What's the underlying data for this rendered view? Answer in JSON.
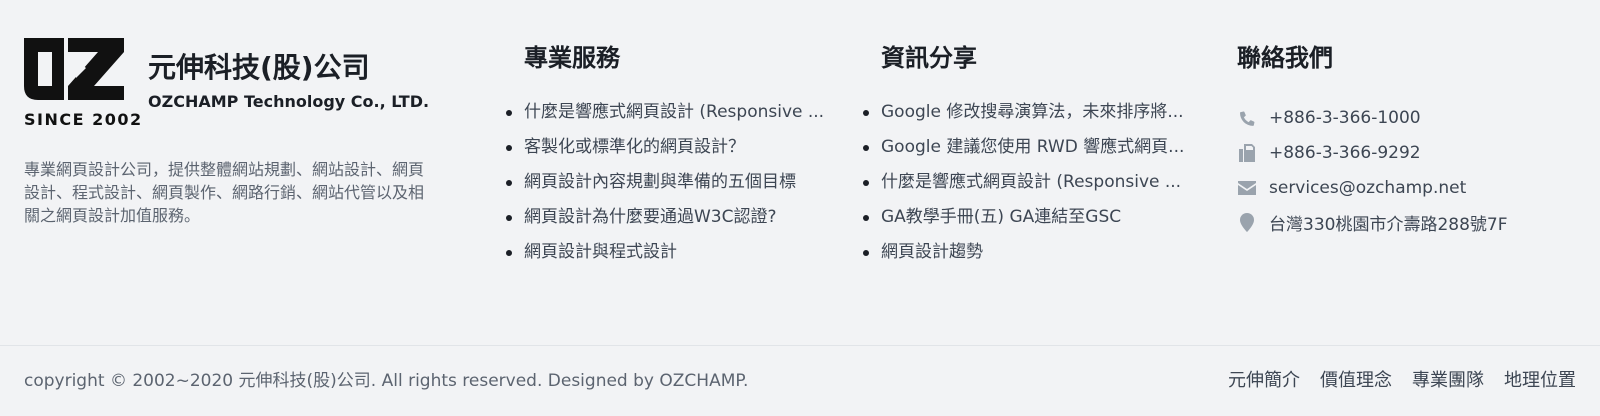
{
  "brand": {
    "since": "SINCE 2002",
    "name_cn": "元伸科技(股)公司",
    "name_en": "OZCHAMP Technology Co., LTD.",
    "description": "專業網頁設計公司，提供整體網站規劃、網站設計、網頁設計、程式設計、網頁製作、網路行銷、網站代管以及相關之網頁設計加值服務。"
  },
  "services": {
    "title": "專業服務",
    "items": [
      "什麼是響應式網頁設計 (Responsive ...",
      "客製化或標準化的網頁設計？",
      "網頁設計內容規劃與準備的五個目標",
      "網頁設計為什麼要通過W3C認證?",
      "網頁設計與程式設計"
    ]
  },
  "news": {
    "title": "資訊分享",
    "items": [
      "Google 修改搜尋演算法，未來排序將...",
      "Google 建議您使用 RWD 響應式網頁...",
      "什麼是響應式網頁設計 (Responsive ...",
      "GA教學手冊(五) GA連結至GSC",
      "網頁設計趨勢"
    ]
  },
  "contact": {
    "title": "聯絡我們",
    "phone": "+886-3-366-1000",
    "fax": "+886-3-366-9292",
    "email": "services@ozchamp.net",
    "address": "台灣330桃園市介壽路288號7F"
  },
  "footer": {
    "copyright": "copyright © 2002~2020 元伸科技(股)公司. All rights reserved. Designed by  OZCHAMP.",
    "nav": [
      "元伸簡介",
      "價值理念",
      "專業團隊",
      "地理位置"
    ]
  },
  "icons": {
    "phone": "phone-icon",
    "fax": "fax-icon",
    "email": "envelope-icon",
    "address": "map-marker-icon"
  },
  "colors": {
    "background": "#f2f3f5",
    "heading": "#1b1f26",
    "text": "#3d4653",
    "icon": "#9aa3ad"
  }
}
